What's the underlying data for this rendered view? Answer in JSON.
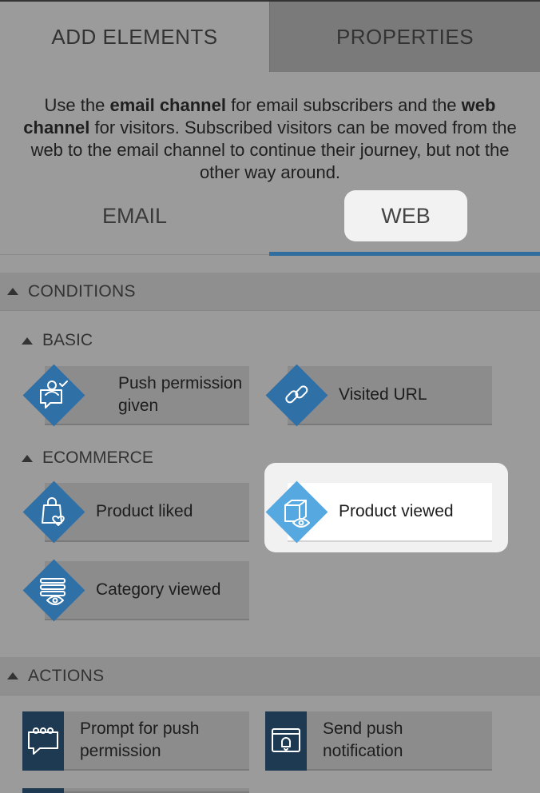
{
  "tabs": {
    "add_elements": "ADD ELEMENTS",
    "properties": "PROPERTIES"
  },
  "description": {
    "p1": "Use the ",
    "email_channel": "email channel",
    "p2": " for email subscribers and the ",
    "web_channel": "web channel",
    "p3": " for visitors. Subscribed visitors can be moved from the web to the email channel to continue their journey, but not the other way around."
  },
  "channels": {
    "email": "EMAIL",
    "web": "WEB",
    "selected": "web"
  },
  "conditions": {
    "header": "CONDITIONS",
    "basic": {
      "header": "BASIC",
      "items": [
        {
          "label_line1": "Push permission",
          "label_line2": "given",
          "icon": "person-chat-check-icon"
        },
        {
          "label": "Visited URL",
          "icon": "link-icon"
        }
      ]
    },
    "ecommerce": {
      "header": "ECOMMERCE",
      "items": [
        {
          "label": "Product liked",
          "icon": "bag-heart-icon"
        },
        {
          "label": "Product viewed",
          "icon": "box-eye-icon",
          "highlighted": true
        },
        {
          "label": "Category viewed",
          "icon": "list-eye-icon"
        }
      ]
    }
  },
  "actions": {
    "header": "ACTIONS",
    "items": [
      {
        "label_line1": "Prompt for push",
        "label_line2": "permission",
        "icon": "chat-dots-icon"
      },
      {
        "label_line1": "Send push",
        "label_line2": "notification",
        "icon": "window-bell-icon"
      }
    ]
  },
  "colors": {
    "diamond": "#2f70a6",
    "diamond_highlight": "#56a8e0",
    "action_icon_bg": "#1e3a52",
    "tab_underline": "#2f6e9f"
  }
}
